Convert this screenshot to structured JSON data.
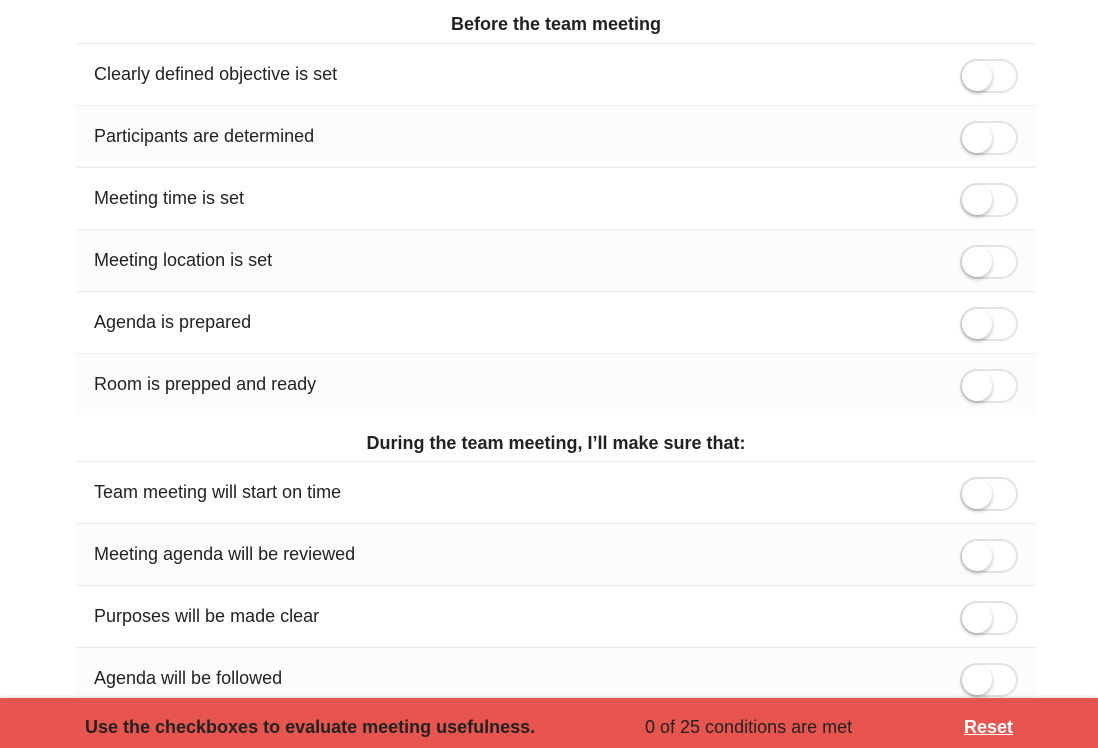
{
  "sections": [
    {
      "title": "Before the team meeting",
      "items": [
        {
          "label": "Clearly defined objective is set",
          "checked": false
        },
        {
          "label": "Participants are determined",
          "checked": false
        },
        {
          "label": "Meeting time is set",
          "checked": false
        },
        {
          "label": "Meeting location is set",
          "checked": false
        },
        {
          "label": "Agenda is prepared",
          "checked": false
        },
        {
          "label": "Room is prepped and ready",
          "checked": false
        }
      ]
    },
    {
      "title": "During the team meeting, I’ll make sure that:",
      "items": [
        {
          "label": "Team meeting will start on time",
          "checked": false
        },
        {
          "label": "Meeting agenda will be reviewed",
          "checked": false
        },
        {
          "label": "Purposes will be made clear",
          "checked": false
        },
        {
          "label": "Agenda will be followed",
          "checked": false
        }
      ]
    }
  ],
  "footer": {
    "hint": "Use the checkboxes to evaluate meeting usefulness.",
    "count": "0 of 25 conditions are met",
    "reset_label": "Reset"
  },
  "colors": {
    "footer_bg": "#e8554e",
    "toggle_border": "#e3e3e3",
    "row_divider": "#ececec"
  }
}
